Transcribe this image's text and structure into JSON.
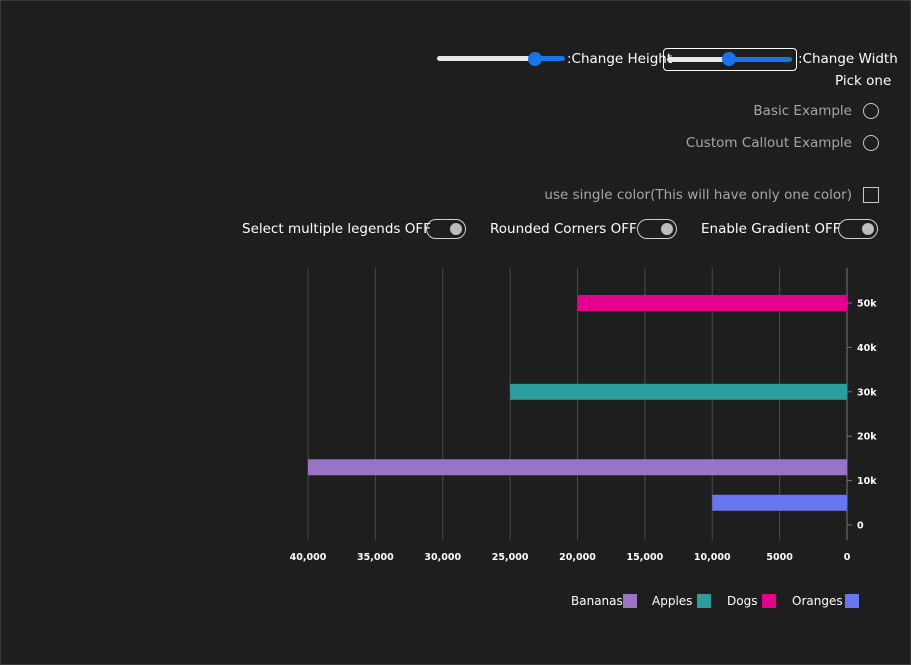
{
  "controls": {
    "height_slider_label": ":Change Height",
    "width_slider_label": ":Change Width",
    "height_slider_value": 0.77,
    "width_slider_value": 0.5,
    "pick_one_label": "Pick one",
    "radio_basic": "Basic Example",
    "radio_custom": "Custom Callout Example",
    "single_color_label": "use single color(This will have only one color)",
    "toggle_legends": "Select multiple legends OFF",
    "toggle_rounded": "Rounded Corners OFF",
    "toggle_gradient": "Enable Gradient OFF"
  },
  "chart_data": {
    "type": "bar",
    "orientation": "horizontal",
    "x_reversed": true,
    "categories": [
      "Oranges",
      "Bananas",
      "Apples",
      "Dogs"
    ],
    "series": [
      {
        "name": "Oranges",
        "y": 5000,
        "value": 10000,
        "color": "#6877f0"
      },
      {
        "name": "Bananas",
        "y": 13000,
        "value": 40000,
        "color": "#9a74c4"
      },
      {
        "name": "Apples",
        "y": 30000,
        "value": 25000,
        "color": "#2a9d9d"
      },
      {
        "name": "Dogs",
        "y": 50000,
        "value": 20000,
        "color": "#e3008c"
      }
    ],
    "xlim": [
      0,
      40000
    ],
    "ylim": [
      0,
      50000
    ],
    "x_ticks": [
      "40,000",
      "35,000",
      "30,000",
      "25,000",
      "20,000",
      "15,000",
      "10,000",
      "5000",
      "0"
    ],
    "x_tick_values": [
      40000,
      35000,
      30000,
      25000,
      20000,
      15000,
      10000,
      5000,
      0
    ],
    "y_ticks": [
      "0",
      "10k",
      "20k",
      "30k",
      "40k",
      "50k"
    ],
    "y_tick_values": [
      0,
      10000,
      20000,
      30000,
      40000,
      50000
    ],
    "grid": true,
    "legend_position": "bottom-right",
    "legend": [
      {
        "name": "Bananas",
        "color": "#9a74c4"
      },
      {
        "name": "Apples",
        "color": "#2a9d9d"
      },
      {
        "name": "Dogs",
        "color": "#e3008c"
      },
      {
        "name": "Oranges",
        "color": "#6877f0"
      }
    ]
  }
}
